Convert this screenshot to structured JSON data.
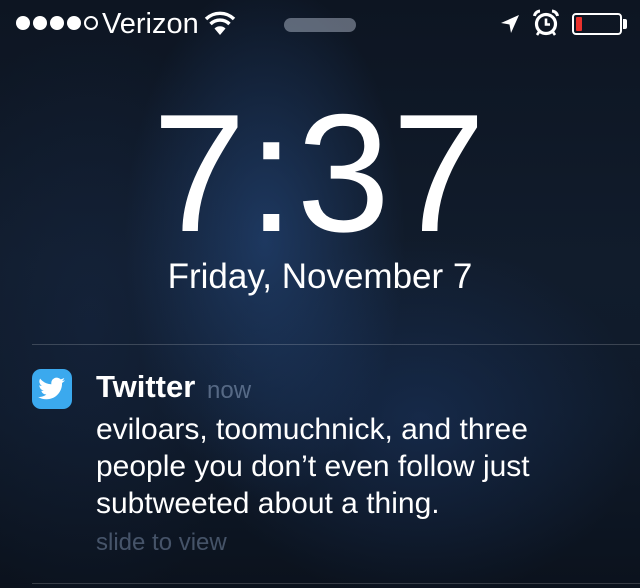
{
  "status_bar": {
    "signal_bars_filled": 4,
    "signal_bars_total": 5,
    "carrier": "Verizon",
    "icons": [
      "wifi-icon",
      "location-icon",
      "alarm-icon",
      "battery-icon"
    ],
    "battery_level": 0.15,
    "battery_color": "#e9322d"
  },
  "lock_screen": {
    "time": "7:37",
    "date": "Friday, November 7"
  },
  "notification": {
    "app_name": "Twitter",
    "app_icon": "twitter-bird-icon",
    "app_icon_color": "#3ba9ee",
    "time": "now",
    "message": "eviloars, toomuchnick, and three people you don’t even follow just subtweeted about a thing.",
    "action_hint": "slide to view"
  }
}
